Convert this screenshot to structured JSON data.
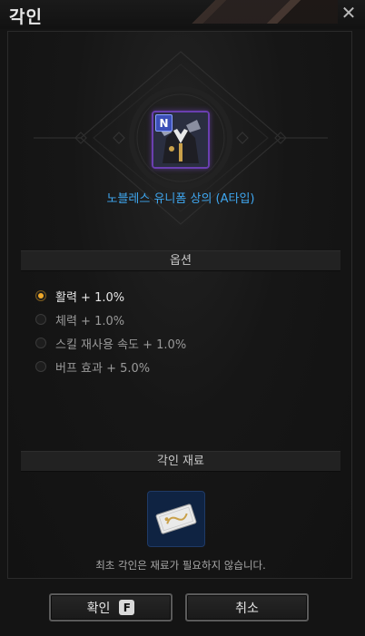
{
  "window": {
    "title": "각인",
    "close_glyph": "✕"
  },
  "item": {
    "grade": "N",
    "name": "노블레스 유니폼 상의 (A타입)",
    "frame_color": "#6a3fb0",
    "name_color": "#3fa7f0"
  },
  "options": {
    "header": "옵션",
    "items": [
      {
        "label": "활력 + 1.0%",
        "selected": true
      },
      {
        "label": "체력 + 1.0%",
        "selected": false
      },
      {
        "label": "스킬 재사용 속도 + 1.0%",
        "selected": false
      },
      {
        "label": "버프 효과 + 5.0%",
        "selected": false
      }
    ]
  },
  "materials": {
    "header": "각인 재료",
    "icon": "ticket-icon",
    "note": "최초 각인은 재료가 필요하지 않습니다."
  },
  "footer": {
    "confirm_label": "확인",
    "confirm_key": "F",
    "cancel_label": "취소"
  },
  "colors": {
    "accent_selected": "#f0a92a",
    "background": "#141414"
  }
}
